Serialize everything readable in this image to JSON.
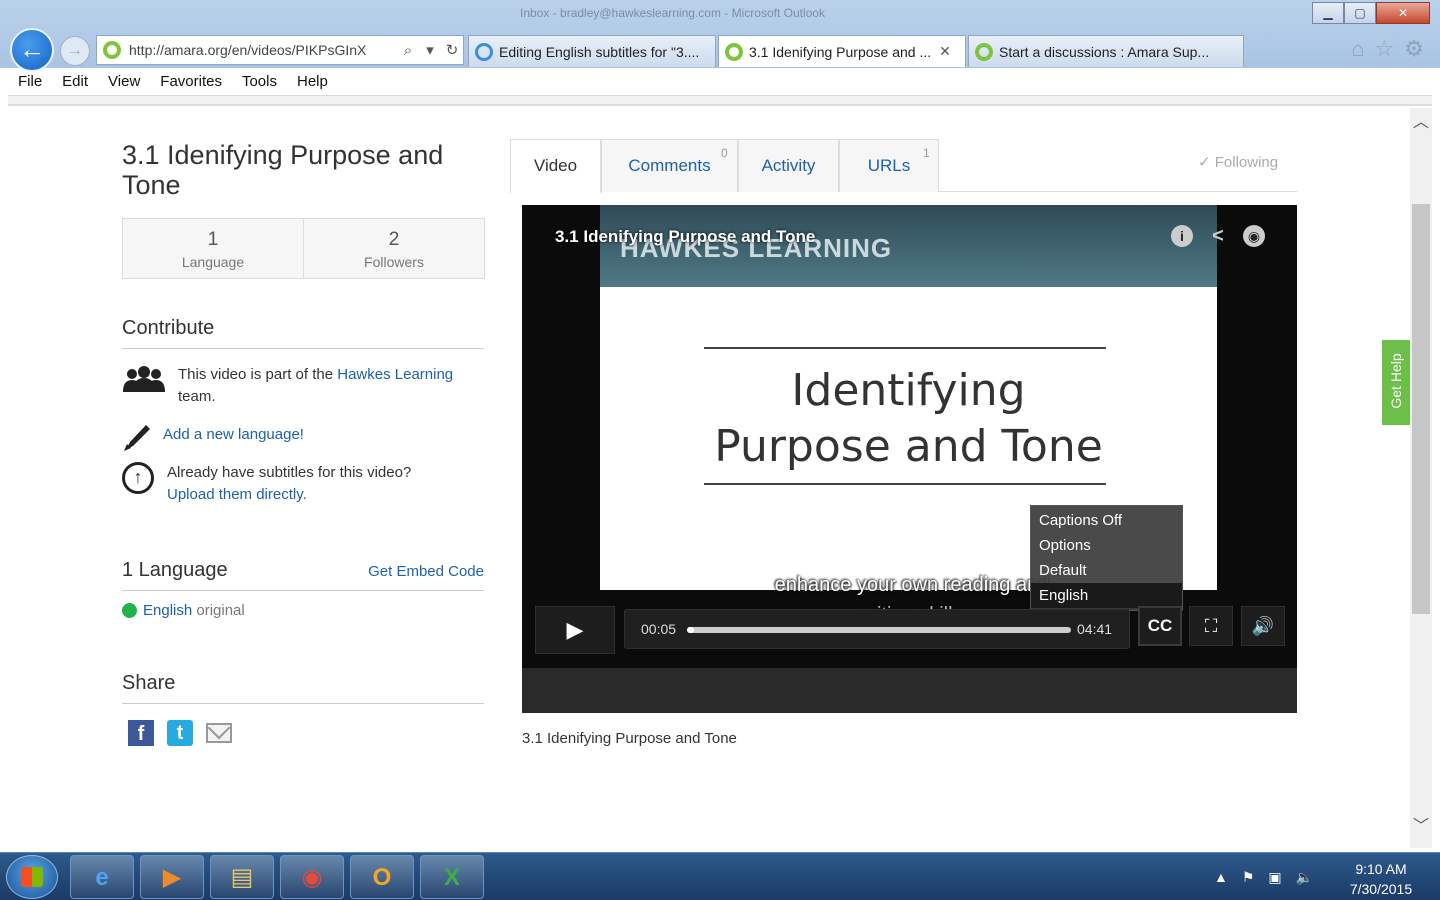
{
  "browser": {
    "window_title": "Inbox - bradley@hawkeslearning.com - Microsoft Outlook",
    "window_buttons": {
      "minimize": "▁",
      "maximize": "▢",
      "close": "✕"
    },
    "address": "http://amara.org/en/videos/PIKPsGInX",
    "tabs": [
      {
        "label": "Editing English subtitles for \"3....",
        "icon": "ie-icon",
        "active": false
      },
      {
        "label": "3.1 Idenifying Purpose and ...",
        "icon": "amara-icon",
        "active": true,
        "close": "✕"
      },
      {
        "label": "Start a discussions : Amara Sup...",
        "icon": "amara-icon",
        "active": false
      }
    ],
    "menu": [
      "File",
      "Edit",
      "View",
      "Favorites",
      "Tools",
      "Help"
    ]
  },
  "page": {
    "title": "3.1 Idenifying Purpose and Tone",
    "stats": [
      {
        "num": "1",
        "label": "Language"
      },
      {
        "num": "2",
        "label": "Followers"
      }
    ],
    "contribute": {
      "heading": "Contribute",
      "team_text_before": "This video is part of the ",
      "team_link": "Hawkes Learning",
      "team_text_after": " team.",
      "add_language": "Add a new language!",
      "upload_question": "Already have subtitles for this video?",
      "upload_link": "Upload them directly."
    },
    "languages": {
      "heading": "1 Language",
      "embed_link": "Get Embed Code",
      "language_link": "English",
      "language_note": " original"
    },
    "share": {
      "heading": "Share"
    },
    "tabs": [
      {
        "label": "Video",
        "count": ""
      },
      {
        "label": "Comments",
        "count": "0"
      },
      {
        "label": "Activity",
        "count": ""
      },
      {
        "label": "URLs",
        "count": "1"
      }
    ],
    "following": "✓ Following",
    "get_help": "Get Help",
    "video_caption": "3.1 Idenifying Purpose and Tone"
  },
  "player": {
    "overlay_title": "3.1 Idenifying Purpose and Tone",
    "slide_brand": "HAWKES LEARNING",
    "slide_line1": "Identifying",
    "slide_line2": "Purpose and Tone",
    "caption_line1": "enhance your own reading and",
    "caption_line2": "writing skills.",
    "current_time": "00:05",
    "duration": "04:41",
    "progress_fraction": 0.018,
    "cc_label": "CC",
    "cc_menu": [
      {
        "label": "Captions Off",
        "selected": false
      },
      {
        "label": "Options",
        "selected": false
      },
      {
        "label": "Default",
        "selected": false
      },
      {
        "label": "English",
        "selected": true
      }
    ]
  },
  "taskbar": {
    "time": "9:10 AM",
    "date": "7/30/2015"
  }
}
